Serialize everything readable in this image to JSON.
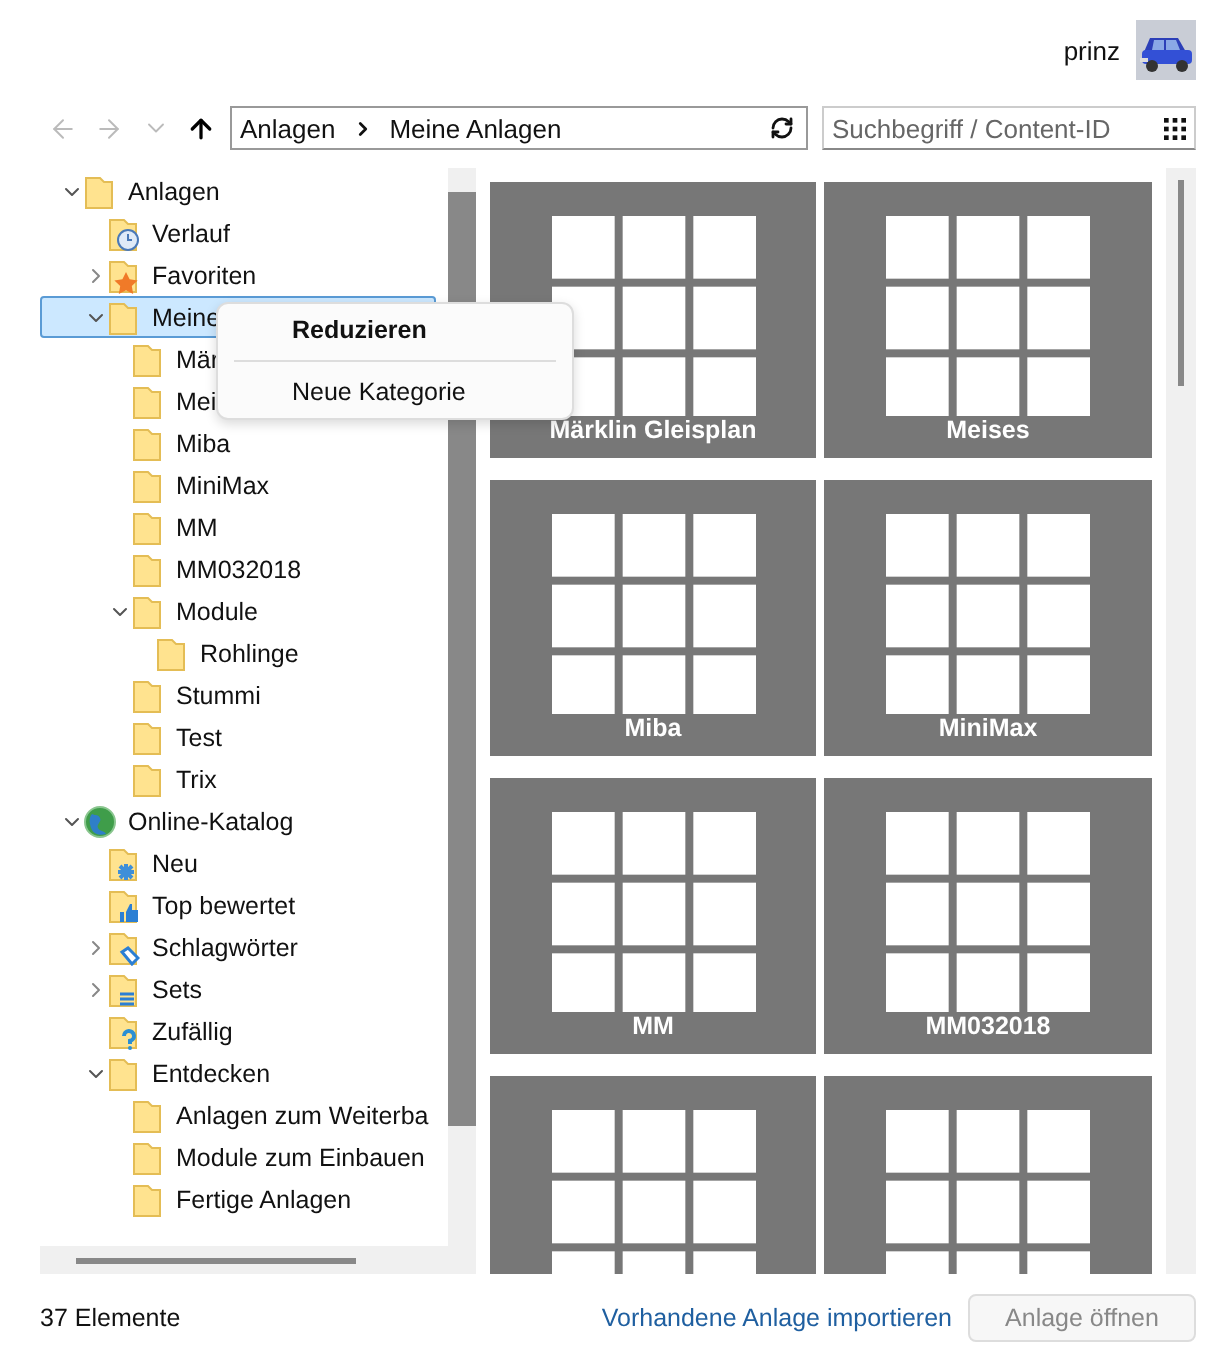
{
  "user": {
    "name": "prinz"
  },
  "nav_buttons": [
    {
      "kind": "back",
      "disabled": true
    },
    {
      "kind": "forward",
      "disabled": true
    },
    {
      "kind": "recent",
      "disabled": true
    },
    {
      "kind": "up",
      "disabled": false
    }
  ],
  "address": {
    "crumbs": [
      "Anlagen",
      "Meine Anlagen"
    ]
  },
  "search": {
    "placeholder": "Suchbegriff / Content-ID"
  },
  "tree": [
    {
      "label": "Anlagen",
      "kind": "folder",
      "expanded": true,
      "selected": false,
      "children": [
        {
          "label": "Verlauf",
          "kind": "history",
          "selected": false
        },
        {
          "label": "Favoriten",
          "kind": "favorites",
          "expanded": false,
          "selected": false
        },
        {
          "label": "Meine",
          "kind": "folder",
          "expanded": true,
          "selected": true,
          "children": [
            {
              "label": "Mär",
              "kind": "folder",
              "selected": false
            },
            {
              "label": "Mei",
              "kind": "folder",
              "selected": false
            },
            {
              "label": "Miba",
              "kind": "folder",
              "selected": false
            },
            {
              "label": "MiniMax",
              "kind": "folder",
              "selected": false
            },
            {
              "label": "MM",
              "kind": "folder",
              "selected": false
            },
            {
              "label": "MM032018",
              "kind": "folder",
              "selected": false
            },
            {
              "label": "Module",
              "kind": "folder",
              "expanded": true,
              "selected": false,
              "children": [
                {
                  "label": "Rohlinge",
                  "kind": "folder",
                  "selected": false
                }
              ]
            },
            {
              "label": "Stummi",
              "kind": "folder",
              "selected": false
            },
            {
              "label": "Test",
              "kind": "folder",
              "selected": false
            },
            {
              "label": "Trix",
              "kind": "folder",
              "selected": false
            }
          ]
        }
      ]
    },
    {
      "label": "Online-Katalog",
      "kind": "globe",
      "expanded": true,
      "selected": false,
      "children": [
        {
          "label": "Neu",
          "kind": "new",
          "selected": false
        },
        {
          "label": "Top bewertet",
          "kind": "top",
          "selected": false
        },
        {
          "label": "Schlagwörter",
          "kind": "tags",
          "expanded": false,
          "selected": false
        },
        {
          "label": "Sets",
          "kind": "sets",
          "expanded": false,
          "selected": false
        },
        {
          "label": "Zufällig",
          "kind": "random",
          "selected": false
        },
        {
          "label": "Entdecken",
          "kind": "folder",
          "expanded": true,
          "selected": false,
          "children": [
            {
              "label": "Anlagen zum Weiterba",
              "kind": "folder",
              "selected": false
            },
            {
              "label": "Module zum Einbauen",
              "kind": "folder",
              "selected": false
            },
            {
              "label": "Fertige Anlagen",
              "kind": "folder",
              "selected": false
            }
          ]
        }
      ]
    }
  ],
  "context_menu": {
    "items": [
      {
        "kind": "entry",
        "label": "Reduzieren",
        "default": true
      },
      {
        "kind": "separator"
      },
      {
        "kind": "entry",
        "label": "Neue Kategorie",
        "default": false
      }
    ]
  },
  "tiles": [
    {
      "kind": "layout",
      "label": "Märklin Gleisplan"
    },
    {
      "kind": "layout",
      "label": "Meises"
    },
    {
      "kind": "layout",
      "label": "Miba"
    },
    {
      "kind": "layout",
      "label": "MiniMax"
    },
    {
      "kind": "layout",
      "label": "MM"
    },
    {
      "kind": "layout",
      "label": "MM032018"
    },
    {
      "kind": "layout"
    },
    {
      "kind": "layout"
    }
  ],
  "status": {
    "count": "37 Elemente"
  },
  "import_link": {
    "label": "Vorhandene Anlage importieren"
  },
  "open_button": {
    "label": "Anlage öffnen",
    "disabled": true
  }
}
